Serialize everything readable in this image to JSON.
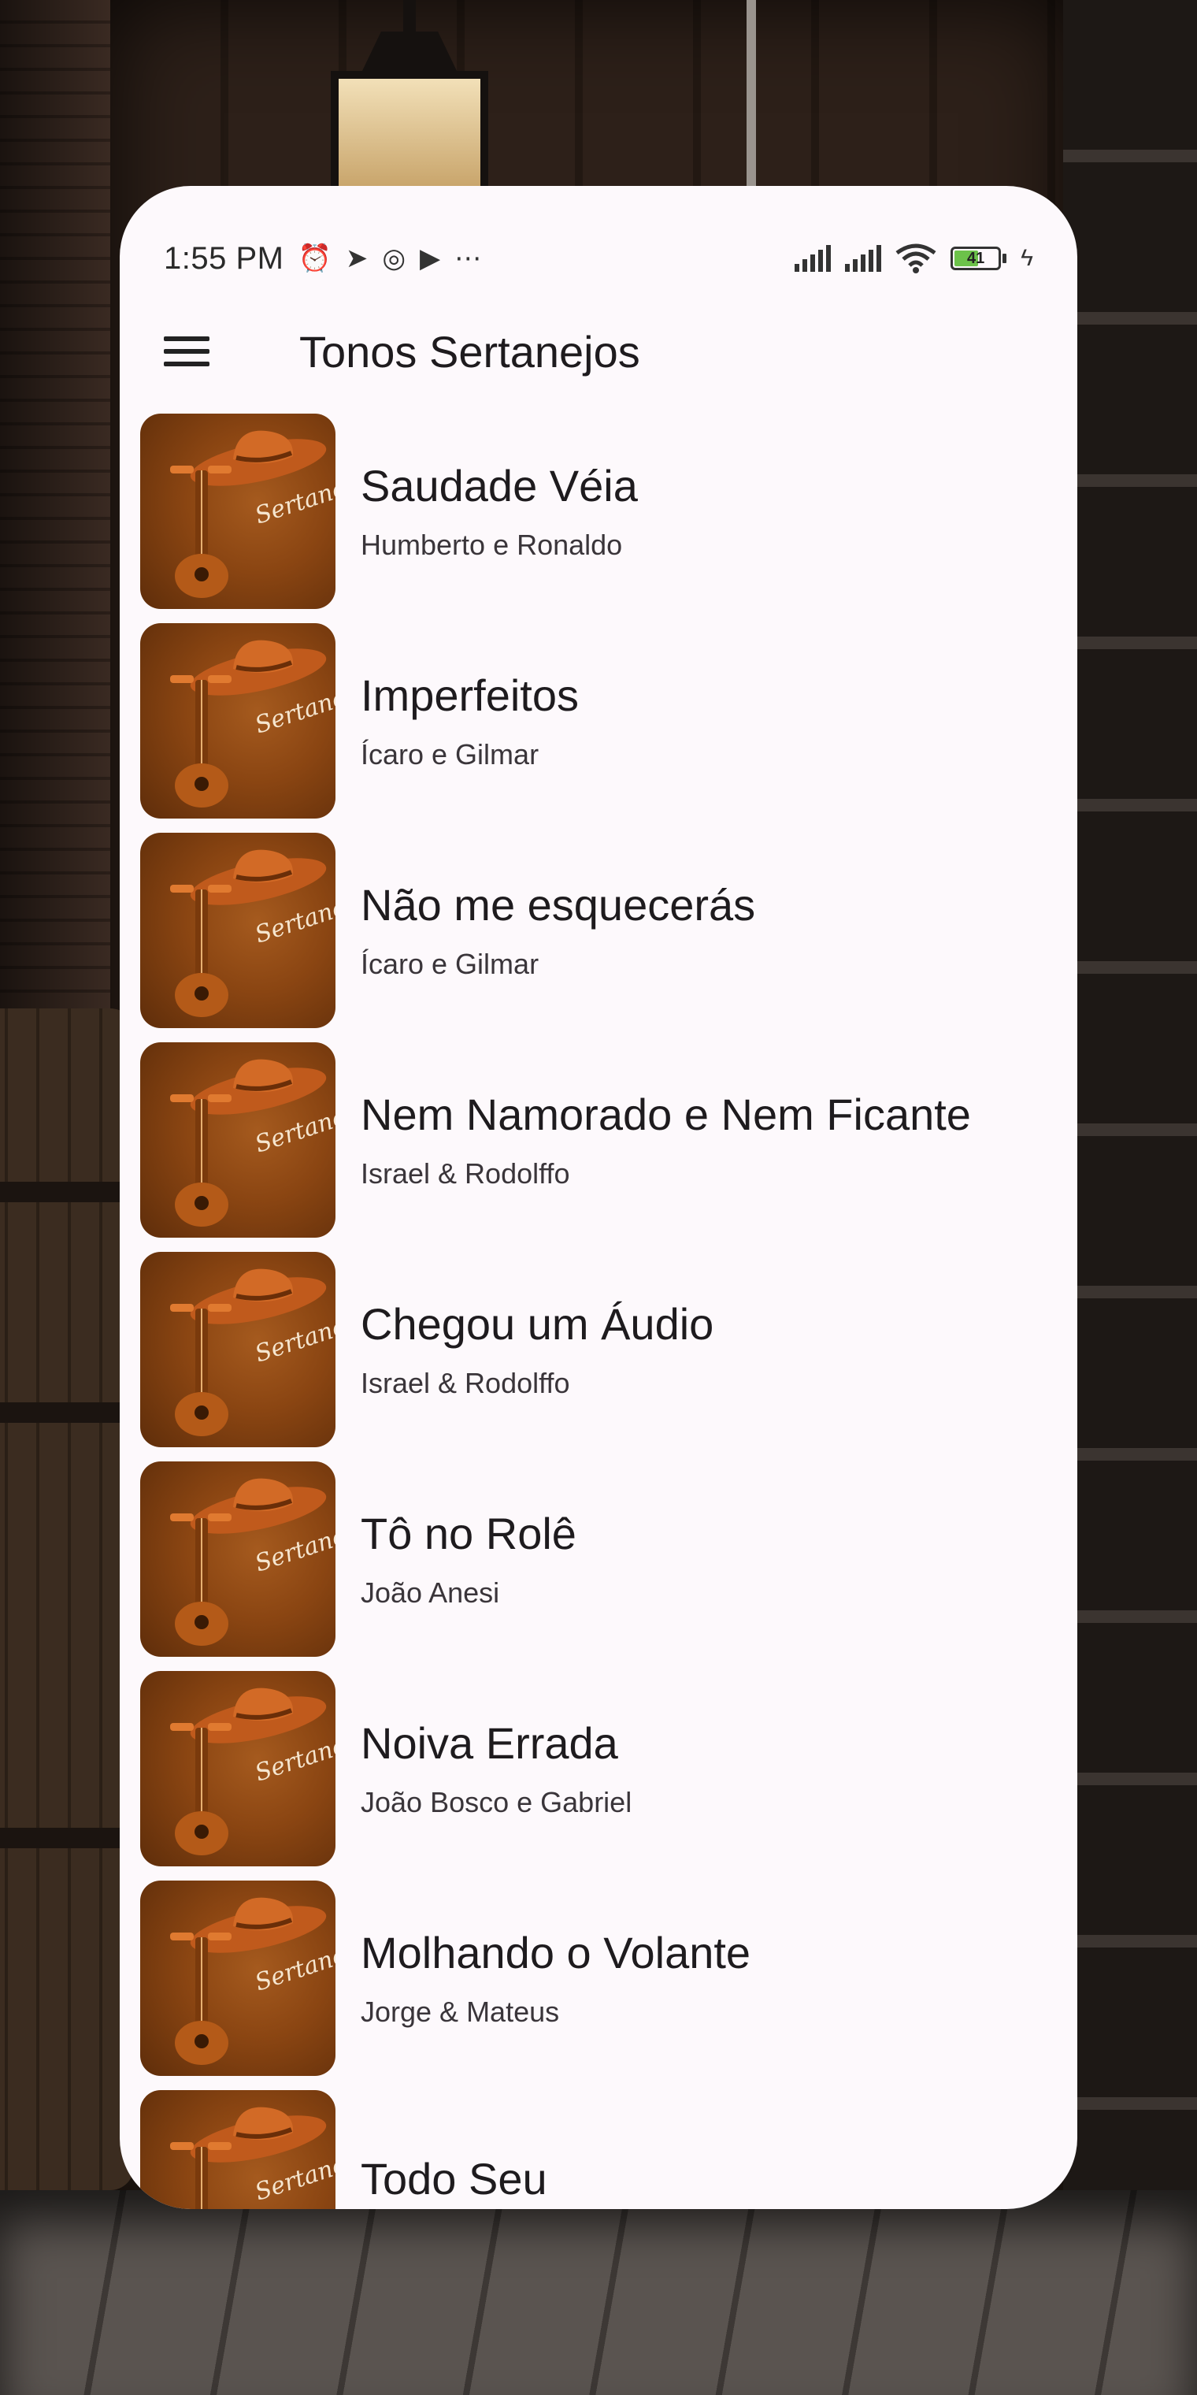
{
  "status_bar": {
    "time": "1:55 PM",
    "icons": [
      "alarm-icon",
      "telegram-icon",
      "instagram-icon",
      "play-store-icon",
      "more-dots-icon"
    ],
    "battery_level": "41",
    "right_icons": [
      "signal-icon",
      "signal-icon",
      "wifi-icon",
      "battery-icon",
      "charging-icon"
    ]
  },
  "app_bar": {
    "title": "Tonos Sertanejos",
    "menu_icon": "hamburger-menu-icon"
  },
  "thumbnail_text": "Sertaneja",
  "songs": [
    {
      "title": "Saudade Véia",
      "artist": "Humberto e Ronaldo"
    },
    {
      "title": "Imperfeitos",
      "artist": "Ícaro e Gilmar"
    },
    {
      "title": "Não me esquecerás",
      "artist": "Ícaro e Gilmar"
    },
    {
      "title": "Nem Namorado e Nem Ficante",
      "artist": "Israel & Rodolffo"
    },
    {
      "title": "Chegou um Áudio",
      "artist": "Israel & Rodolffo"
    },
    {
      "title": "Tô no Rolê",
      "artist": "João Anesi"
    },
    {
      "title": "Noiva Errada",
      "artist": "João Bosco e Gabriel"
    },
    {
      "title": "Molhando o Volante",
      "artist": "Jorge & Mateus"
    },
    {
      "title": "Todo Seu",
      "artist": ""
    }
  ],
  "colors": {
    "card_background": "#fdf9fc",
    "thumb_brown": "#8a4512",
    "text_primary": "#1e1b1e"
  }
}
